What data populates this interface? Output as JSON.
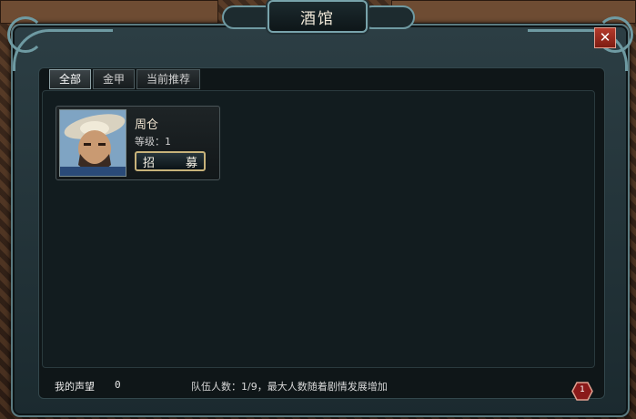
{
  "window": {
    "title": "酒馆",
    "close_label": "✕"
  },
  "tabs": [
    {
      "label": "全部",
      "active": true
    },
    {
      "label": "金甲",
      "active": false
    },
    {
      "label": "当前推荐",
      "active": false
    }
  ],
  "heroes": [
    {
      "name": "周仓",
      "level_text": "等级：1",
      "recruit_label": "招募"
    }
  ],
  "footer": {
    "prestige_label": "我的声望",
    "prestige_value": "0",
    "party_note": "队伍人数：1/9，最大人数随着剧情发展增加",
    "badge_count": "1"
  },
  "colors": {
    "frame": "#5b7a80",
    "close_red": "#b43a2b",
    "button_gold": "#c7b27a",
    "badge_red": "#8a1a1a"
  }
}
